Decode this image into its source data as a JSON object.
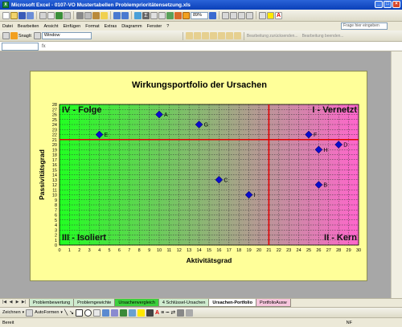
{
  "window": {
    "title": "Microsoft Excel - 0107-VO Mustertabellen Problemprioritätensetzung.xls",
    "app_icon": "excel-icon"
  },
  "menu": {
    "items": [
      "Datei",
      "Bearbeiten",
      "Ansicht",
      "Einfügen",
      "Format",
      "Extras",
      "Diagramm",
      "Fenster",
      "?"
    ],
    "help_placeholder": "Frage hier eingeben"
  },
  "toolbar": {
    "zoom": "89%",
    "snagit_label": "SnagIt",
    "snagit_target": "Window",
    "review_reply": "Bearbeitung zurücksenden...",
    "review_end": "Bearbeitung beenden..."
  },
  "sheet_tabs": [
    {
      "label": "Problembewertung",
      "color": "#cfeccf",
      "active": false
    },
    {
      "label": "Problemgewichte",
      "color": "#cfeccf",
      "active": false
    },
    {
      "label": "Ursachenvergleich",
      "color": "#3ccf3c",
      "active": false
    },
    {
      "label": "4 Schlüssel-Ursachen",
      "color": "#cfeccf",
      "active": false
    },
    {
      "label": "Ursachen-Portfolio",
      "color": "#ffffff",
      "active": true
    },
    {
      "label": "PortfolioAusw",
      "color": "#f7c6dd",
      "active": false
    }
  ],
  "drawbar": {
    "draw_label": "Zeichnen",
    "autoshapes_label": "AutoFormen"
  },
  "status": {
    "left": "Bereit",
    "right": "NF"
  },
  "colors": {
    "green": "#22ff22",
    "pink": "#ff66cc",
    "crosshair": "#e00000",
    "marker": "#0a0acc",
    "chart_bg": "#ffff99"
  },
  "chart_data": {
    "type": "scatter",
    "title": "Wirkungsportfolio der Ursachen",
    "xlabel": "Aktivitätsgrad",
    "ylabel": "Passivitätsgrad",
    "xlim": [
      0,
      30
    ],
    "ylim": [
      0,
      28
    ],
    "xticks": [
      0,
      1,
      2,
      3,
      4,
      5,
      6,
      7,
      8,
      9,
      10,
      11,
      12,
      13,
      14,
      15,
      16,
      17,
      18,
      19,
      20,
      21,
      22,
      23,
      24,
      25,
      26,
      27,
      28,
      29,
      30
    ],
    "yticks": [
      0,
      1,
      2,
      3,
      4,
      5,
      6,
      7,
      8,
      9,
      10,
      11,
      12,
      13,
      14,
      15,
      16,
      17,
      18,
      19,
      20,
      21,
      22,
      23,
      24,
      25,
      26,
      27,
      28
    ],
    "grid": true,
    "divider_x": 21,
    "divider_y": 21,
    "quadrants": {
      "top_left": "IV - Folge",
      "top_right": "I - Vernetzt",
      "bottom_left": "III - Isoliert",
      "bottom_right": "II - Kern"
    },
    "points": [
      {
        "label": "A",
        "x": 10,
        "y": 26
      },
      {
        "label": "B",
        "x": 26,
        "y": 12
      },
      {
        "label": "C",
        "x": 16,
        "y": 13
      },
      {
        "label": "D",
        "x": 28,
        "y": 20
      },
      {
        "label": "E",
        "x": 4,
        "y": 22
      },
      {
        "label": "F",
        "x": 25,
        "y": 22
      },
      {
        "label": "G",
        "x": 14,
        "y": 24
      },
      {
        "label": "H",
        "x": 26,
        "y": 19
      },
      {
        "label": "I",
        "x": 19,
        "y": 10
      }
    ]
  }
}
